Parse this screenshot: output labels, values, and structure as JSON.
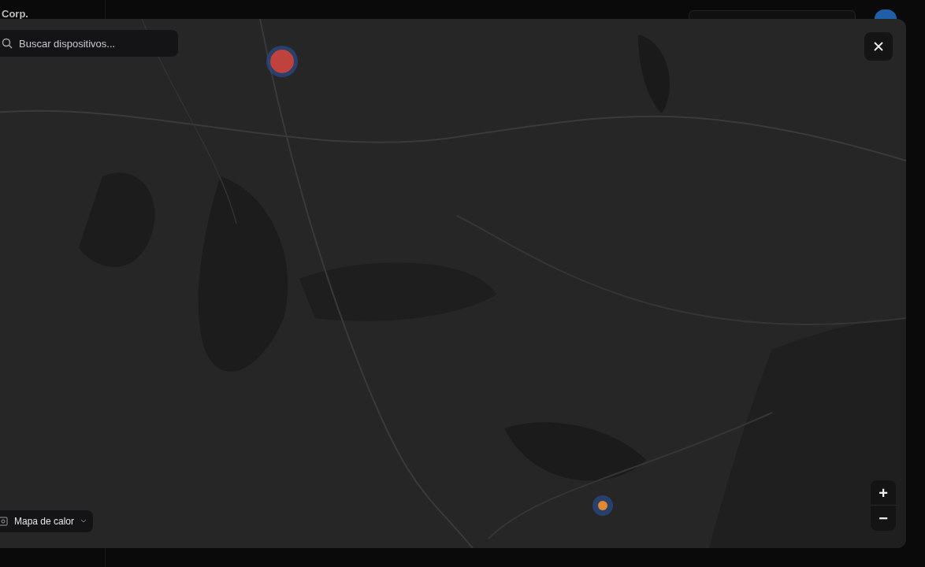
{
  "app": {
    "brand": "Corp."
  },
  "map_modal": {
    "search": {
      "placeholder": "Buscar dispositivos..."
    },
    "layer_select": {
      "label": "Mapa de calor"
    },
    "zoom_in": "+",
    "zoom_out": "−"
  }
}
